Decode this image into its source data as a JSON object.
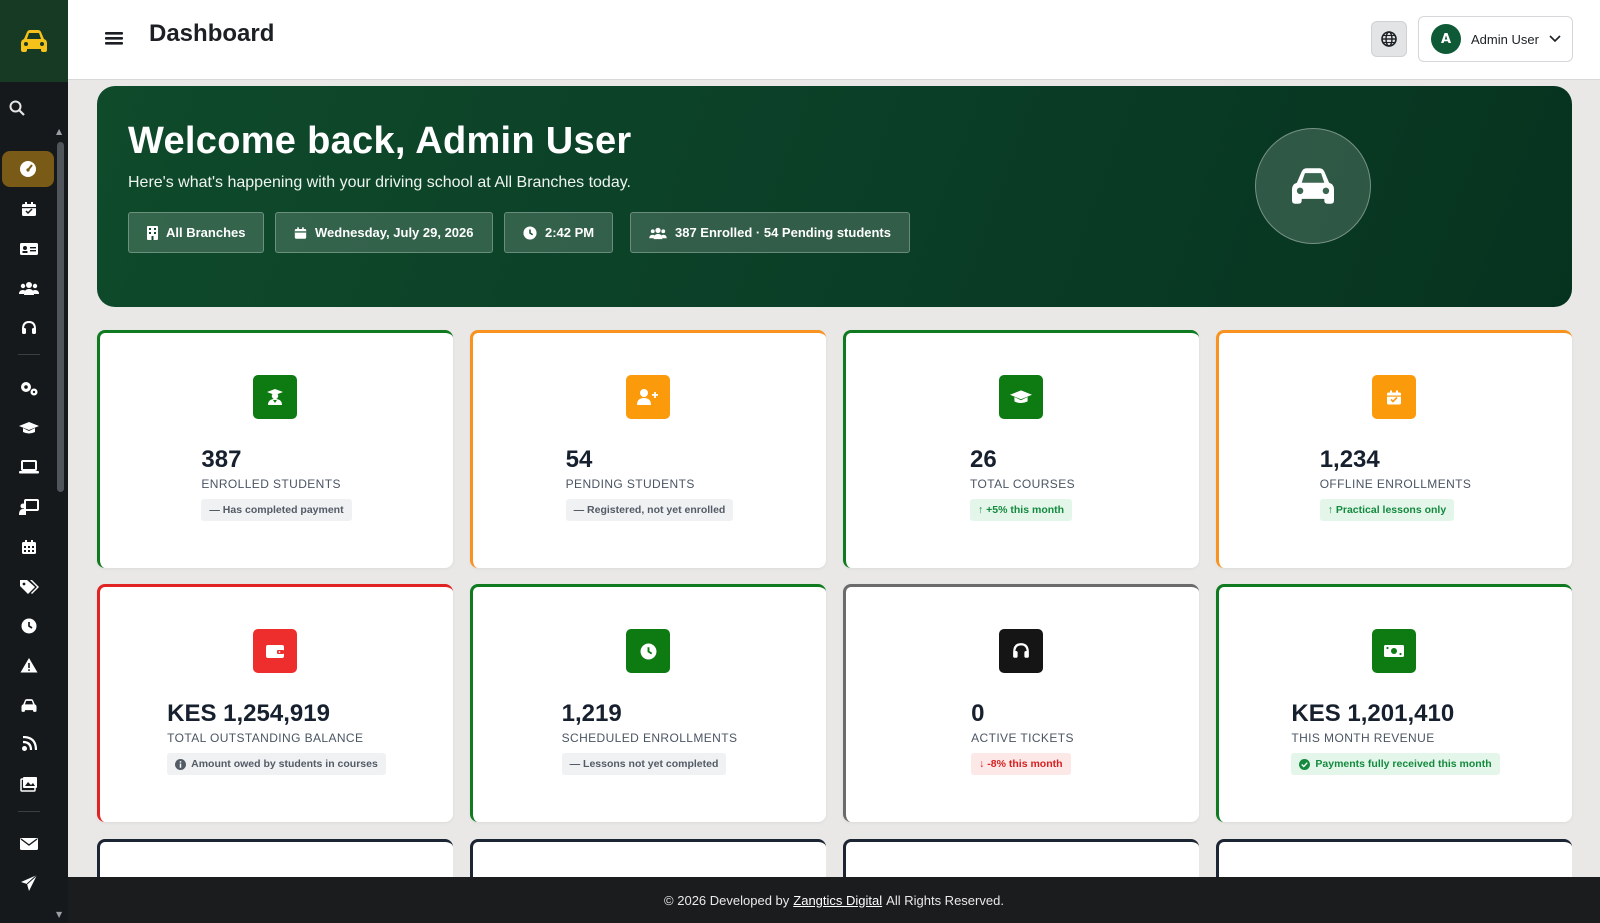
{
  "header": {
    "title": "Dashboard",
    "user_initial": "A",
    "user_name": "Admin User"
  },
  "sidebar": {
    "logo_icon": "car-icon",
    "search_icon": "search-icon",
    "items": [
      {
        "name": "dashboard",
        "icon": "gauge-icon",
        "active": true
      },
      {
        "name": "schedule",
        "icon": "calendar-check-icon"
      },
      {
        "name": "id-cards",
        "icon": "id-card-icon"
      },
      {
        "name": "students",
        "icon": "users-icon"
      },
      {
        "name": "support",
        "icon": "headset-icon"
      },
      {
        "name": "settings",
        "icon": "gears-icon"
      },
      {
        "name": "courses",
        "icon": "graduation-cap-icon"
      },
      {
        "name": "online-classes",
        "icon": "laptop-icon"
      },
      {
        "name": "instructors",
        "icon": "chalkboard-teacher-icon"
      },
      {
        "name": "calendar",
        "icon": "calendar-icon"
      },
      {
        "name": "tags",
        "icon": "tags-icon"
      },
      {
        "name": "history",
        "icon": "clock-icon"
      },
      {
        "name": "alerts",
        "icon": "warning-icon"
      },
      {
        "name": "vehicles",
        "icon": "car-icon"
      },
      {
        "name": "blog",
        "icon": "blog-icon"
      },
      {
        "name": "gallery",
        "icon": "images-icon"
      },
      {
        "name": "messages",
        "icon": "envelope-icon"
      },
      {
        "name": "send",
        "icon": "paper-plane-icon"
      }
    ]
  },
  "hero": {
    "title": "Welcome back, Admin User",
    "subtitle": "Here's what's happening with your driving school at All Branches today.",
    "chips": {
      "branch": "All Branches",
      "date": "Wednesday, July 29, 2026",
      "time": "2:42 PM",
      "enrolled": "387 Enrolled · 54 Pending students"
    }
  },
  "stats": [
    {
      "value": "387",
      "label": "ENROLLED STUDENTS",
      "badge": "— Has completed payment",
      "badge_style": "neutral",
      "accent": "#0f7a1f",
      "icon": "user-graduate-icon"
    },
    {
      "value": "54",
      "label": "PENDING STUDENTS",
      "badge": "— Registered, not yet enrolled",
      "badge_style": "neutral",
      "accent": "#f7931e",
      "icon": "user-plus-icon"
    },
    {
      "value": "26",
      "label": "TOTAL COURSES",
      "badge": "↑ +5% this month",
      "badge_style": "up",
      "accent": "#0f7a1f",
      "icon": "graduation-cap-icon"
    },
    {
      "value": "1,234",
      "label": "OFFLINE ENROLLMENTS",
      "badge": "↑ Practical lessons only",
      "badge_style": "up",
      "accent": "#f7931e",
      "icon": "calendar-check-icon"
    },
    {
      "value": "KES 1,254,919",
      "label": "TOTAL OUTSTANDING BALANCE",
      "badge": "Amount owed by students in courses",
      "badge_style": "neutral",
      "accent": "#e02323",
      "icon": "wallet-icon"
    },
    {
      "value": "1,219",
      "label": "SCHEDULED ENROLLMENTS",
      "badge": "— Lessons not yet completed",
      "badge_style": "neutral",
      "accent": "#0f7a1f",
      "icon": "clock-icon"
    },
    {
      "value": "0",
      "label": "ACTIVE TICKETS",
      "badge": "↓ -8% this month",
      "badge_style": "down",
      "accent": "#6b6b6b",
      "icon": "headset-icon"
    },
    {
      "value": "KES 1,201,410",
      "label": "THIS MONTH REVENUE",
      "badge": "Payments fully received this month",
      "badge_style": "up",
      "accent": "#0f7a1f",
      "icon": "money-bill-icon"
    }
  ],
  "footer": {
    "prefix": "© 2026 Developed by",
    "link": "Zangtics Digital",
    "suffix": "All Rights Reserved."
  }
}
